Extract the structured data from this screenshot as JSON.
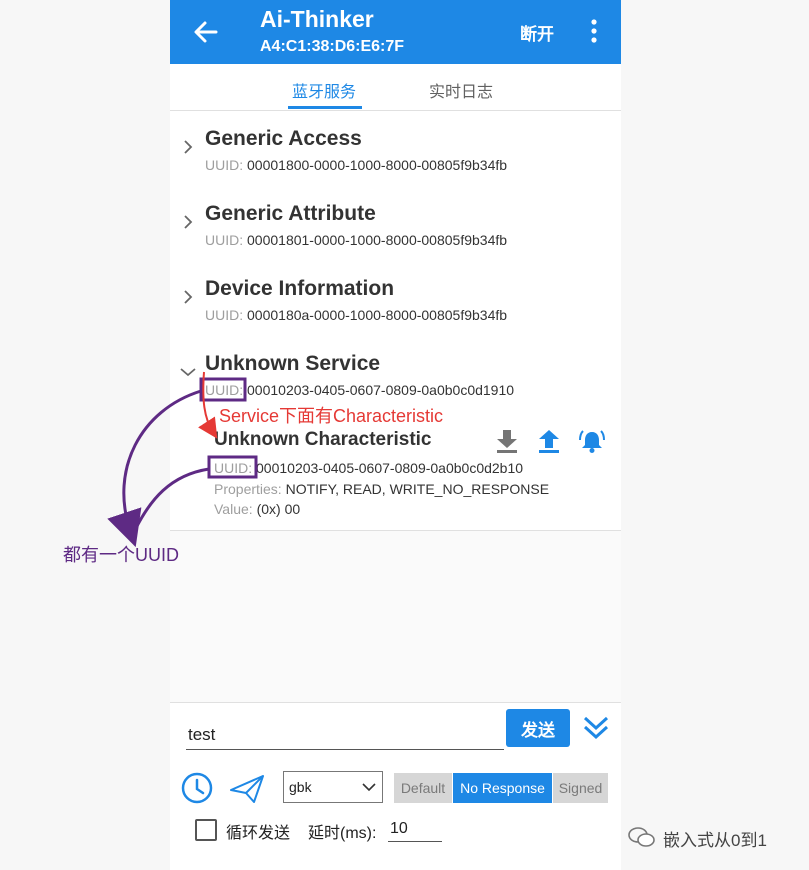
{
  "header": {
    "title": "Ai-Thinker",
    "subtitle": "A4:C1:38:D6:E6:7F",
    "disconnect_label": "断开"
  },
  "tabs": [
    {
      "label": "蓝牙服务",
      "active": true
    },
    {
      "label": "实时日志",
      "active": false
    }
  ],
  "services": [
    {
      "name": "Generic Access",
      "uuid_label": "UUID:",
      "uuid": "00001800-0000-1000-8000-00805f9b34fb"
    },
    {
      "name": "Generic Attribute",
      "uuid_label": "UUID:",
      "uuid": "00001801-0000-1000-8000-00805f9b34fb"
    },
    {
      "name": "Device Information",
      "uuid_label": "UUID:",
      "uuid": "0000180a-0000-1000-8000-00805f9b34fb"
    },
    {
      "name": "Unknown Service",
      "uuid_label": "UUID:",
      "uuid": "00010203-0405-0607-0809-0a0b0c0d1910"
    }
  ],
  "characteristic": {
    "name": "Unknown Characteristic",
    "uuid_label": "UUID:",
    "uuid": "00010203-0405-0607-0809-0a0b0c0d2b10",
    "properties_label": "Properties:",
    "properties": "NOTIFY, READ, WRITE_NO_RESPONSE",
    "value_label": "Value:",
    "value": "(0x) 00",
    "icons": [
      "download-icon",
      "upload-icon",
      "notify-bell-icon"
    ]
  },
  "send": {
    "input_value": "test",
    "button_label": "发送",
    "encoding": "gbk",
    "modes": [
      "Default",
      "No Response",
      "Signed"
    ],
    "active_mode": "No Response",
    "loop_label": "循环发送",
    "loop_checked": false,
    "delay_label": "延时(ms):",
    "delay_value": "10"
  },
  "annotations": {
    "red_text": "Service下面有Characteristic",
    "purple_text": "都有一个UUID"
  },
  "watermark": "嵌入式从0到1",
  "colors": {
    "primary": "#1e88e5",
    "annotation_red": "#e53935",
    "annotation_purple": "#5e2a84"
  }
}
